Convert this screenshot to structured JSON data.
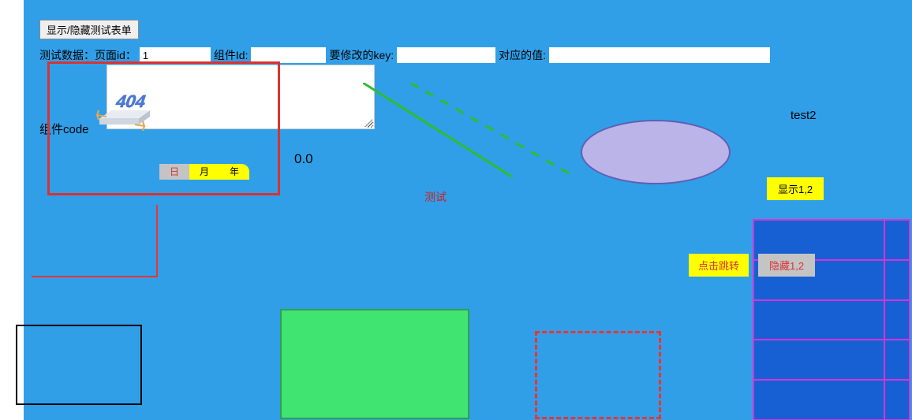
{
  "toggle_button": "显示/隐藏测试表单",
  "form": {
    "prefix": "测试数据：页面id：",
    "page_id": "1",
    "comp_label": "组件Id:",
    "comp_id": "",
    "key_label": "要修改的key:",
    "key": "",
    "val_label": "对应的值:",
    "val": ""
  },
  "code_label": "组件code",
  "tabs": {
    "day": "日",
    "month": "月",
    "year": "年"
  },
  "version": "0.0",
  "test_label": "测试",
  "test2_label": "test2",
  "show12": "显示1,2",
  "click_jump": "点击跳转",
  "hide12": "隐藏1,2",
  "icon_404": "404"
}
